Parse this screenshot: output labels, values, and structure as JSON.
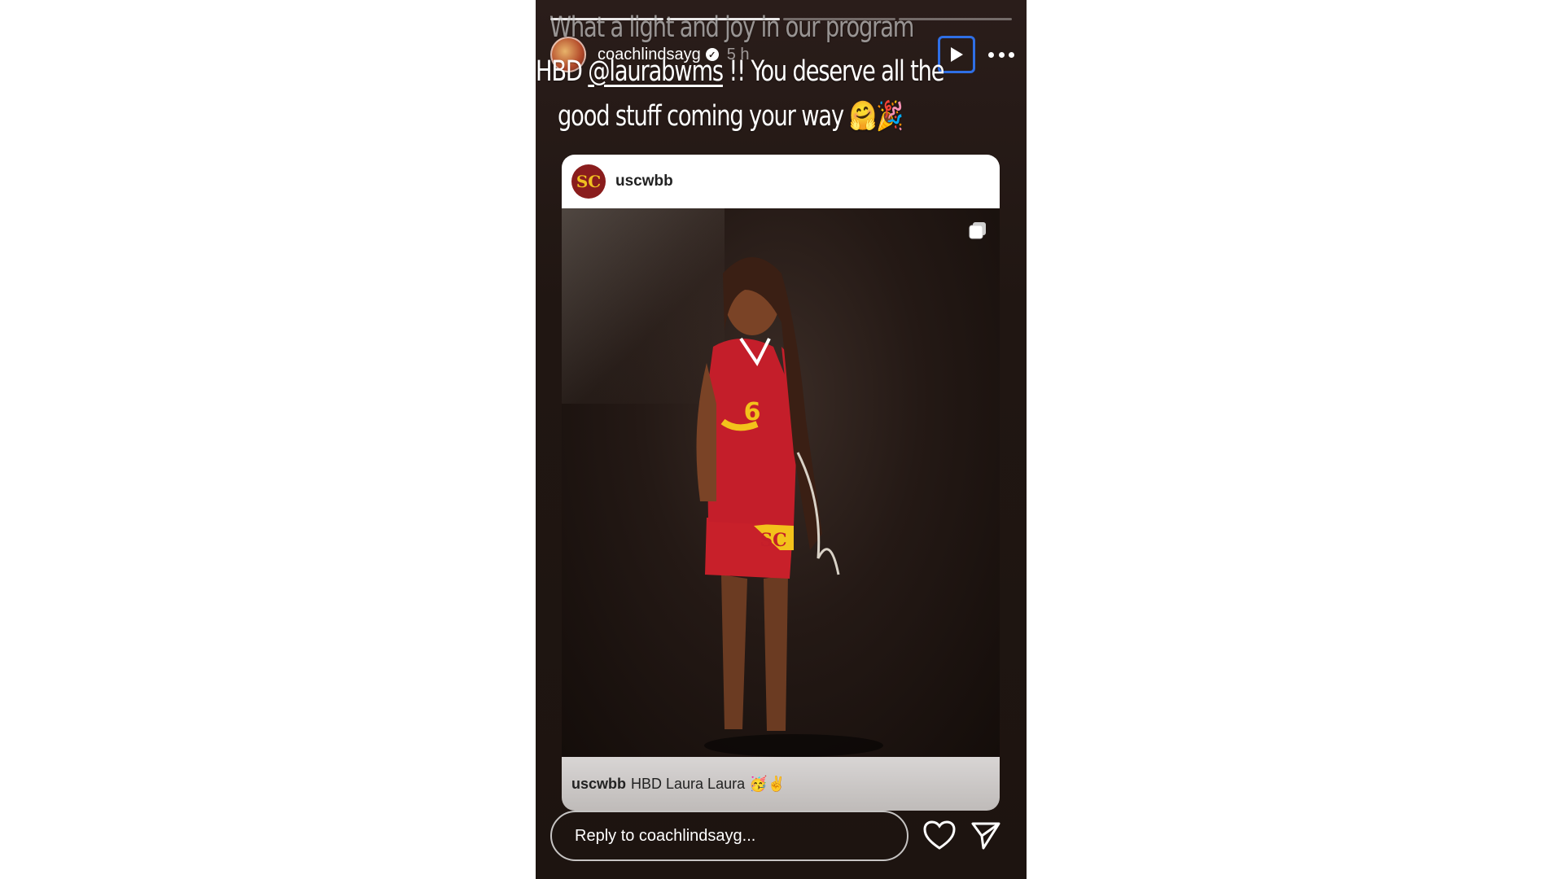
{
  "story": {
    "progress_segments": 4,
    "caption_line1": "What a light and joy in our program",
    "caption_line2_prefix": "HBD ",
    "caption_line2_mention": "@laurabwms",
    "caption_line2_suffix": " !! You deserve all the",
    "caption_line3": "good stuff coming your way 🤗🎉",
    "username": "coachlindsayg",
    "verified_mark": "✓",
    "time": "5 h",
    "icons": [
      "play-icon",
      "more-icon",
      "heart-icon",
      "send-icon",
      "multiple-posts-icon"
    ]
  },
  "post": {
    "avatar_text": "SC",
    "username": "uscwbb",
    "caption_user": "uscwbb",
    "caption_text": "HBD Laura Laura 🥳✌️",
    "jersey_number": "6",
    "jersey_logo": "SC"
  },
  "reply": {
    "placeholder": "Reply to coachlindsayg..."
  },
  "colors": {
    "story_bg": "#201612",
    "play_button_border": "#2f6fe6",
    "usc_cardinal": "#9b1b1b",
    "usc_gold": "#f0c020"
  }
}
